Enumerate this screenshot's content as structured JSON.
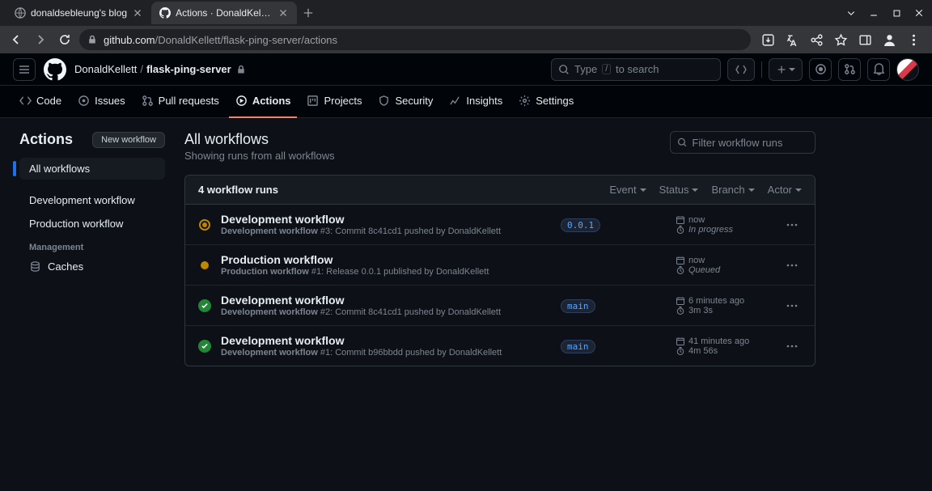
{
  "browser": {
    "tabs": [
      {
        "title": "donaldsebleung's blog",
        "active": false
      },
      {
        "title": "Actions · DonaldKellett/fla...",
        "active": true
      }
    ],
    "url_domain": "github.com",
    "url_path": "/DonaldKellett/flask-ping-server/actions"
  },
  "github": {
    "owner": "DonaldKellett",
    "repo": "flask-ping-server",
    "search_prompt": "Type",
    "search_key": "/",
    "search_suffix": "to search"
  },
  "repo_nav": {
    "code": "Code",
    "issues": "Issues",
    "pulls": "Pull requests",
    "actions": "Actions",
    "projects": "Projects",
    "security": "Security",
    "insights": "Insights",
    "settings": "Settings"
  },
  "sidebar": {
    "title": "Actions",
    "new_btn": "New workflow",
    "all": "All workflows",
    "items": [
      {
        "label": "Development workflow"
      },
      {
        "label": "Production workflow"
      }
    ],
    "management": "Management",
    "caches": "Caches"
  },
  "content": {
    "title": "All workflows",
    "subtitle": "Showing runs from all workflows",
    "filter_placeholder": "Filter workflow runs",
    "count": "4 workflow runs",
    "filters": {
      "event": "Event",
      "status": "Status",
      "branch": "Branch",
      "actor": "Actor"
    }
  },
  "runs": [
    {
      "status": "inprogress",
      "title": "Development workflow",
      "desc_name": "Development workflow",
      "desc_rest": " #3: Commit 8c41cd1 pushed by DonaldKellett",
      "branch": "0.0.1",
      "time": "now",
      "duration": "In progress",
      "duration_italic": true
    },
    {
      "status": "queued",
      "title": "Production workflow",
      "desc_name": "Production workflow",
      "desc_rest": " #1: Release 0.0.1 published by DonaldKellett",
      "branch": "",
      "time": "now",
      "duration": "Queued",
      "duration_italic": true
    },
    {
      "status": "success",
      "title": "Development workflow",
      "desc_name": "Development workflow",
      "desc_rest": " #2: Commit 8c41cd1 pushed by DonaldKellett",
      "branch": "main",
      "time": "6 minutes ago",
      "duration": "3m 3s",
      "duration_italic": false
    },
    {
      "status": "success",
      "title": "Development workflow",
      "desc_name": "Development workflow",
      "desc_rest": " #1: Commit b96bbdd pushed by DonaldKellett",
      "branch": "main",
      "time": "41 minutes ago",
      "duration": "4m 56s",
      "duration_italic": false
    }
  ]
}
